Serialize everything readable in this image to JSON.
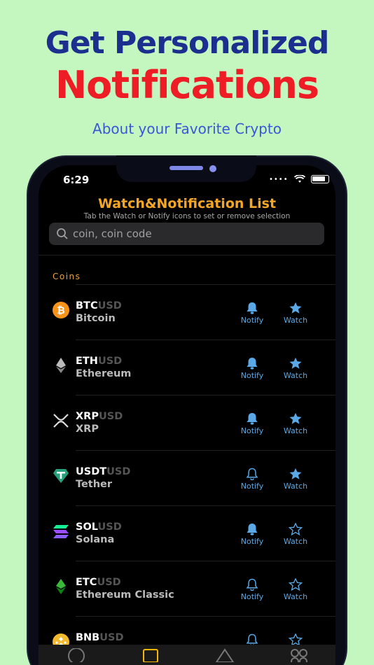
{
  "promo": {
    "line1": "Get Personalized",
    "line2": "Notifications",
    "line3": "About your Favorite Crypto"
  },
  "status": {
    "time": "6:29"
  },
  "app": {
    "title": "Watch&Notification List",
    "subtitle": "Tab the Watch or Notify icons to set or remove selection",
    "search_placeholder": "coin, coin code",
    "section": "Coins",
    "notify_label": "Notify",
    "watch_label": "Watch"
  },
  "coins": [
    {
      "sym": "BTC",
      "quote": "USD",
      "name": "Bitcoin",
      "notify": true,
      "watch": true,
      "icon": "bitcoin-icon"
    },
    {
      "sym": "ETH",
      "quote": "USD",
      "name": "Ethereum",
      "notify": true,
      "watch": true,
      "icon": "ethereum-icon"
    },
    {
      "sym": "XRP",
      "quote": "USD",
      "name": "XRP",
      "notify": true,
      "watch": true,
      "icon": "xrp-icon"
    },
    {
      "sym": "USDT",
      "quote": "USD",
      "name": "Tether",
      "notify": false,
      "watch": true,
      "icon": "tether-icon"
    },
    {
      "sym": "SOL",
      "quote": "USD",
      "name": "Solana",
      "notify": true,
      "watch": false,
      "icon": "solana-icon"
    },
    {
      "sym": "ETC",
      "quote": "USD",
      "name": "Ethereum Classic",
      "notify": false,
      "watch": false,
      "icon": "ethereum-classic-icon"
    },
    {
      "sym": "BNB",
      "quote": "USD",
      "name": "",
      "notify": false,
      "watch": false,
      "icon": "bnb-icon"
    }
  ],
  "colors": {
    "accent": "#5aa9e6",
    "title": "#f5a623",
    "headline_blue": "#1c2f8f",
    "headline_red": "#ee1c24"
  },
  "tabbar": [
    "circle-tab-icon",
    "square-tab-icon",
    "triangle-tab-icon",
    "grid-tab-icon"
  ]
}
